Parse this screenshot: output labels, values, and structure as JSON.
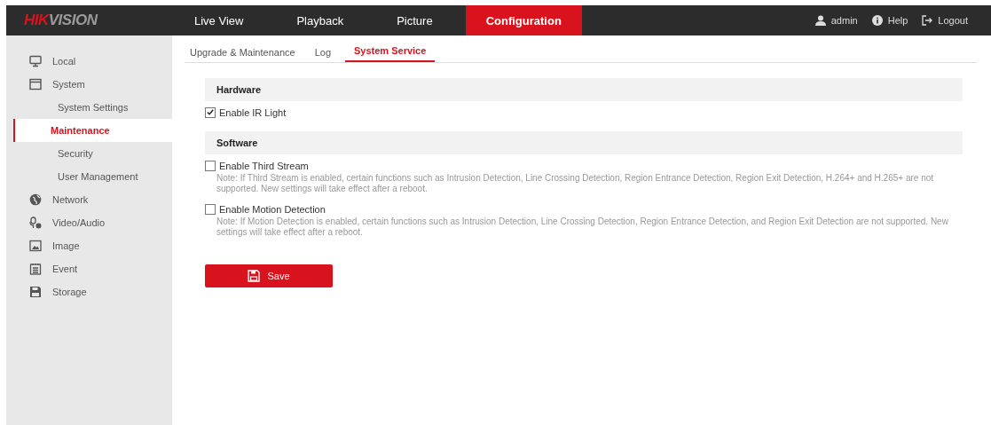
{
  "logo": {
    "accent": "HIK",
    "rest": "VISION"
  },
  "nav": [
    {
      "label": "Live View",
      "selected": false
    },
    {
      "label": "Playback",
      "selected": false
    },
    {
      "label": "Picture",
      "selected": false
    },
    {
      "label": "Configuration",
      "selected": true
    }
  ],
  "user_menu": [
    {
      "kind": "user",
      "label": "admin"
    },
    {
      "kind": "help",
      "label": "Help"
    },
    {
      "kind": "logout",
      "label": "Logout"
    }
  ],
  "sidebar": {
    "items": [
      {
        "kind": "monitor",
        "label": "Local",
        "selected": false
      },
      {
        "kind": "window",
        "label": "System",
        "selected": false,
        "children": [
          {
            "label": "System Settings",
            "selected": false
          },
          {
            "label": "Maintenance",
            "selected": true
          },
          {
            "label": "Security",
            "selected": false
          },
          {
            "label": "User Management",
            "selected": false
          }
        ]
      },
      {
        "kind": "globe",
        "label": "Network",
        "selected": false
      },
      {
        "kind": "mic",
        "label": "Video/Audio",
        "selected": false
      },
      {
        "kind": "image",
        "label": "Image",
        "selected": false
      },
      {
        "kind": "list",
        "label": "Event",
        "selected": false
      },
      {
        "kind": "disk",
        "label": "Storage",
        "selected": false
      }
    ]
  },
  "tabs": [
    {
      "label": "Upgrade & Maintenance",
      "selected": false
    },
    {
      "label": "Log",
      "selected": false
    },
    {
      "label": "System Service",
      "selected": true
    }
  ],
  "sections": [
    {
      "title": "Hardware",
      "options": [
        {
          "label": "Enable IR Light",
          "checked": true
        }
      ]
    },
    {
      "title": "Software",
      "options": [
        {
          "label": "Enable Third Stream",
          "checked": false,
          "note": "Note: If Third Stream is enabled, certain functions such as Intrusion Detection, Line Crossing Detection, Region Entrance Detection, Region Exit Detection, H.264+ and H.265+ are not supported. New settings will take effect after a reboot."
        },
        {
          "label": "Enable Motion Detection",
          "checked": false,
          "note": "Note: If Motion Detection is enabled, certain functions such as Intrusion Detection, Line Crossing Detection, Region Entrance Detection, and Region Exit Detection are not supported. New settings will take effect after a reboot."
        }
      ]
    }
  ],
  "save_button": "Save"
}
